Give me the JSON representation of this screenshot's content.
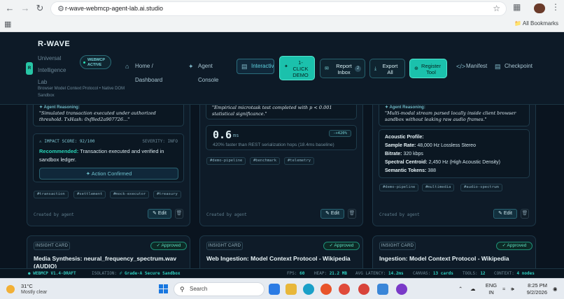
{
  "browser": {
    "url": "r-wave-webmcp-agent-lab.ai.studio",
    "all_bookmarks": "All Bookmarks"
  },
  "header": {
    "brand_title": "R-WAVE",
    "brand_lines": [
      "Universal",
      "Intelligence",
      "Lab"
    ],
    "brand_tagline": "Browser Model Context Protocol • Native DOM Sandbox",
    "badge_line1": "WEBMCP",
    "badge_line2": "ACTIVE",
    "nav": {
      "home": "Home / Dashboard",
      "agent_console": "Agent Console",
      "interactive": "Interactiv"
    },
    "click_demo": {
      "line1": "1-",
      "line2": "CLICK",
      "line3": "DEMO"
    },
    "report_inbox": {
      "line1": "Report",
      "line2": "Inbox",
      "count": "2"
    },
    "export_all": {
      "line1": "Export",
      "line2": "All"
    },
    "register_tool": {
      "line1": "Register",
      "line2": "Tool"
    },
    "manifest": "Manifest",
    "checkpoint": "Checkpoint"
  },
  "cards_top": [
    {
      "reasoning_label": "Agent Reasoning:",
      "reasoning": "\"Simulated transaction executed under authorized threshold. TxHash: 0xf8ed2a907726...\"",
      "impact_label": "IMPACT SCORE: 92/100",
      "severity": "SEVERITY: INFO",
      "recommend_label": "Recommended:",
      "recommend_text": "Transaction executed and verified in sandbox ledger.",
      "action": "Action Confirmed",
      "tags": [
        "#transaction",
        "#settlement",
        "#mock-executor",
        "#treasury"
      ],
      "created": "Created by agent",
      "edit": "Edit"
    },
    {
      "reasoning": "\"Empirical microtask test completed with p < 0.001 statistical significance.\"",
      "metric_value": "0.6",
      "metric_unit": "ms",
      "metric_delta": "-+420%",
      "metric_note": "420% faster than REST serialization hops (18.4ms baseline)",
      "tags": [
        "#demo-pipeline",
        "#benchmark",
        "#telemetry"
      ],
      "created": "Created by agent",
      "edit": "Edit"
    },
    {
      "reasoning_label": "Agent Reasoning:",
      "reasoning": "\"Multi-modal stream parsed locally inside client browser sandbox without leaking raw audio frames.\"",
      "acoustic_title": "Acoustic Profile:",
      "acoustic": [
        {
          "k": "Sample Rate:",
          "v": "48,000 Hz Lossless Stereo"
        },
        {
          "k": "Bitrate:",
          "v": "320 kbps"
        },
        {
          "k": "Spectral Centroid:",
          "v": "2,450 Hz (High Acoustic Density)"
        },
        {
          "k": "Semantic Tokens:",
          "v": "388"
        }
      ],
      "tags": [
        "#demo-pipeline",
        "#multimedia",
        "#audio-spectrum"
      ],
      "created": "Created by agent",
      "edit": "Edit"
    }
  ],
  "cards_bottom": [
    {
      "tag": "INSIGHT CARD",
      "status": "Approved",
      "title": "Media Synthesis: neural_frequency_spectrum.wav",
      "title2": "(AUDIO)"
    },
    {
      "tag": "INSIGHT CARD",
      "status": "Approved",
      "title": "Web Ingestion: Model Context Protocol - Wikipedia",
      "title2": ""
    },
    {
      "tag": "INSIGHT CARD",
      "status": "Approved",
      "title": "Ingestion: Model Context Protocol - Wikipedia",
      "title2": ""
    }
  ],
  "statusbar": {
    "version": "WEBMCP V1.4-DRAFT",
    "isolation_label": "ISOLATION:",
    "isolation_value": "Grade-A Secure Sandbox",
    "fps_label": "FPS:",
    "fps": "60",
    "heap_label": "HEAP:",
    "heap": "21.2 MB",
    "latency_label": "AVG LATENCY:",
    "latency": "14.2ms",
    "canvas_label": "CANVAS:",
    "canvas": "13 cards",
    "tools_label": "TOOLS:",
    "tools": "12",
    "context_label": "CONTEXT:",
    "context": "4 nodes"
  },
  "taskbar": {
    "temp": "31°C",
    "weather": "Mostly clear",
    "search": "Search",
    "lang1": "ENG",
    "lang2": "IN",
    "time": "8:25 PM",
    "date": "9/2/2026"
  }
}
